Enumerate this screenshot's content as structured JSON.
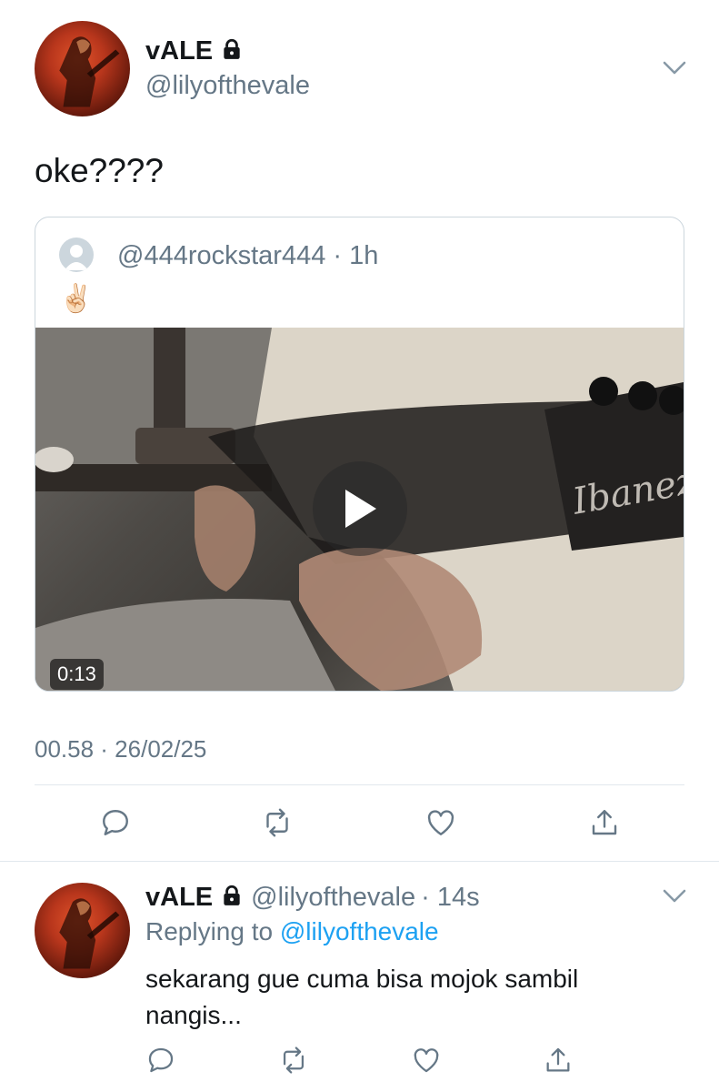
{
  "main_tweet": {
    "display_name": "vALE",
    "handle": "@lilyofthevale",
    "text": "oke????",
    "timestamp": "00.58 · 26/02/25"
  },
  "quoted_tweet": {
    "handle": "@444rockstar444",
    "time": "· 1h",
    "text": "✌🏻",
    "video_duration": "0:13",
    "video_brand_text": "Ibanez"
  },
  "reply_tweet": {
    "display_name": "vALE",
    "handle": "@lilyofthevale",
    "time": "· 14s",
    "replying_prefix": "Replying to",
    "replying_to": "@lilyofthevale",
    "text": "sekarang gue cuma bisa mojok sambil nangis..."
  },
  "icons": [
    "lock-icon",
    "chevron-down-icon",
    "reply-icon",
    "retweet-icon",
    "like-icon",
    "share-icon",
    "play-icon"
  ],
  "colors": {
    "link": "#1da1f2",
    "secondary_text": "#657786",
    "divider": "#e1e8ed"
  }
}
